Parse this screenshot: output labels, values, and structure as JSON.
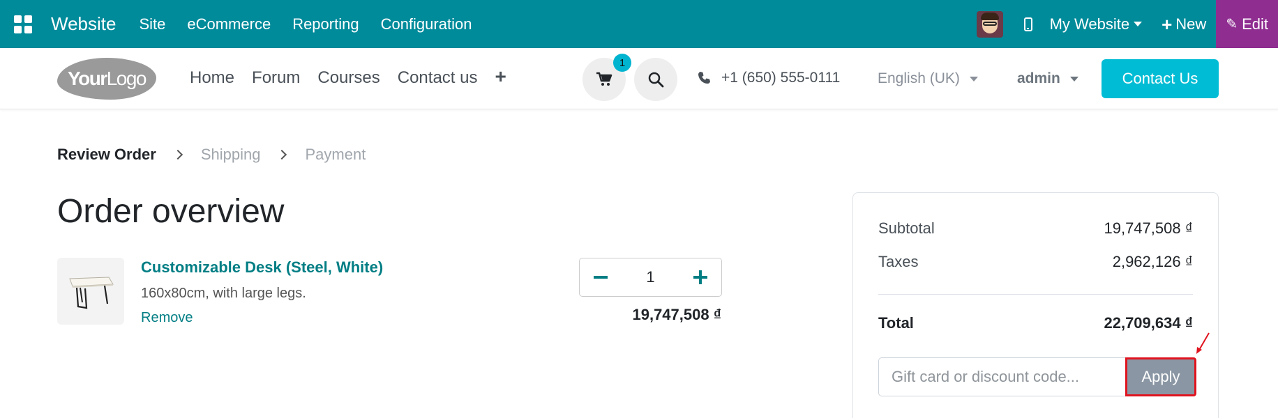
{
  "admin_bar": {
    "app_name": "Website",
    "menu": [
      "Site",
      "eCommerce",
      "Reporting",
      "Configuration"
    ],
    "my_website": "My Website",
    "new_label": "New",
    "edit_label": "Edit"
  },
  "site_header": {
    "logo_text_bold": "Your",
    "logo_text_light": "Logo",
    "nav": [
      "Home",
      "Forum",
      "Courses",
      "Contact us"
    ],
    "cart_count": "1",
    "phone": "+1 (650) 555-0111",
    "language": "English (UK)",
    "user": "admin",
    "contact_button": "Contact Us"
  },
  "steps": [
    "Review Order",
    "Shipping",
    "Payment"
  ],
  "page_title": "Order overview",
  "cart_line": {
    "product_name": "Customizable Desk (Steel, White)",
    "description": "160x80cm, with large legs.",
    "remove_label": "Remove",
    "quantity": "1",
    "price": "19,747,508 ₫"
  },
  "summary": {
    "subtotal_label": "Subtotal",
    "subtotal_value": "19,747,508 ₫",
    "taxes_label": "Taxes",
    "taxes_value": "2,962,126 ₫",
    "total_label": "Total",
    "total_value": "22,709,634 ₫",
    "coupon_placeholder": "Gift card or discount code...",
    "apply_label": "Apply"
  },
  "colors": {
    "admin_bar": "#008b9b",
    "edit_button": "#8f2d91",
    "accent": "#017e84",
    "contact_button": "#00bcd4",
    "highlight": "#e0141f"
  }
}
